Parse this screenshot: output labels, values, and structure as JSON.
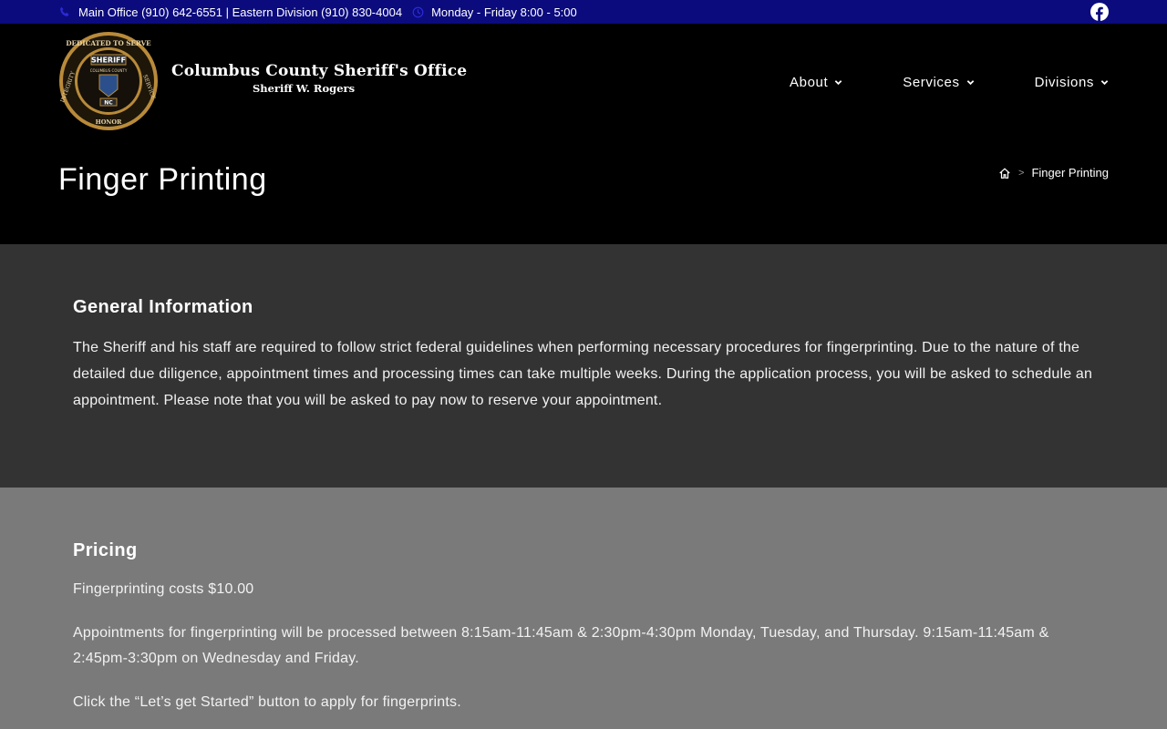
{
  "topbar": {
    "phone_icon": "phone-icon",
    "phones": "Main Office (910) 642-6551 | Eastern Division (910) 830-4004",
    "clock_icon": "clock-icon",
    "hours": "Monday - Friday 8:00 - 5:00",
    "social_icon": "facebook-icon"
  },
  "header": {
    "logo_name": "sheriff-badge-logo",
    "logo_text": {
      "top": "DEDICATED TO SERVE",
      "left": "INTEGRITY",
      "bottom": "HONOR",
      "right": "SERVICE",
      "banner": "SHERIFF",
      "county": "COLUMBUS COUNTY",
      "state": "NC"
    },
    "title": "Columbus County Sheriff's Office",
    "subtitle": "Sheriff W. Rogers"
  },
  "nav": {
    "items": [
      {
        "label": "About"
      },
      {
        "label": "Services"
      },
      {
        "label": "Divisions"
      }
    ]
  },
  "page": {
    "title": "Finger Printing",
    "breadcrumb_current": "Finger Printing",
    "breadcrumb_sep": ">"
  },
  "general": {
    "heading": "General Information",
    "body": "The Sheriff and his staff are required to follow strict federal guidelines when performing necessary procedures for fingerprinting. Due to the nature of the detailed due diligence, appointment times and processing times can take multiple weeks. During the application process, you will be asked to schedule an appointment. Please note that you will be asked to pay now to reserve your appointment."
  },
  "pricing": {
    "heading": "Pricing",
    "cost": "Fingerprinting costs $10.00",
    "hours": "Appointments for fingerprinting will be processed between 8:15am-11:45am & 2:30pm-4:30pm  Monday, Tuesday, and Thursday. 9:15am-11:45am & 2:45pm-3:30pm on Wednesday and Friday.",
    "cta_text": "Click the “Let’s get Started” button to apply for fingerprints."
  },
  "colors": {
    "topbar_bg": "#0b0b7e",
    "section1_bg": "#333333",
    "section2_bg": "#7a7a7a",
    "badge_gold": "#b88a3a"
  }
}
